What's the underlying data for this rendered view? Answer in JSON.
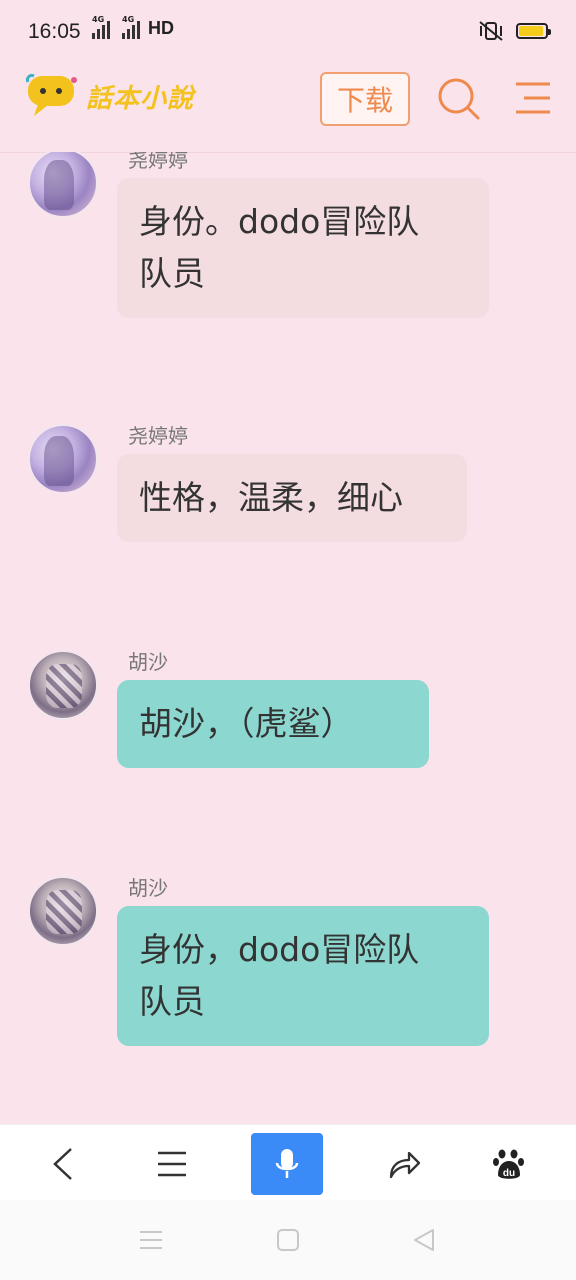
{
  "status_bar": {
    "time": "16:05",
    "signal1": "4G",
    "signal2": "4G",
    "hd": "HD"
  },
  "header": {
    "logo_text": "話本小說",
    "download_label": "下载",
    "accent": "#ee8a4e"
  },
  "messages": [
    {
      "name": "尧婷婷",
      "lines": [
        "身份。dodo冒险队",
        "队员"
      ],
      "style": "pink"
    },
    {
      "name": "尧婷婷",
      "lines": [
        "性格，温柔，细心"
      ],
      "style": "pink"
    },
    {
      "name": "胡沙",
      "lines": [
        "胡沙，（虎鲨）"
      ],
      "style": "teal"
    },
    {
      "name": "胡沙",
      "lines": [
        "身份，dodo冒险队",
        "队员"
      ],
      "style": "teal"
    }
  ],
  "toolbar": {
    "items": [
      "back-icon",
      "menu-list-icon",
      "microphone-icon",
      "share-icon",
      "baidu-paw-icon"
    ],
    "baidu_text": "du"
  },
  "colors": {
    "background": "#fae3ea",
    "pink_bubble": "#f4dde1",
    "teal_bubble": "#8cd8d0",
    "voice_button": "#3a8bf7"
  }
}
